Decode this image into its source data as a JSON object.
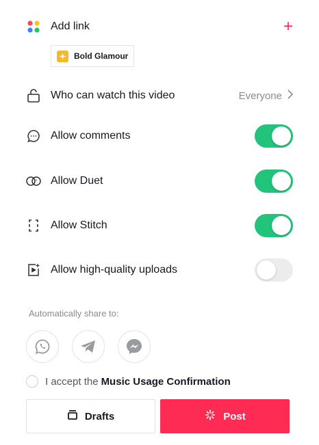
{
  "add_link": {
    "label": "Add link",
    "plus": "+"
  },
  "chip": {
    "label": "Bold Glamour"
  },
  "privacy": {
    "label": "Who can watch this video",
    "value": "Everyone"
  },
  "settings": [
    {
      "label": "Allow comments",
      "enabled": true
    },
    {
      "label": "Allow Duet",
      "enabled": true
    },
    {
      "label": "Allow Stitch",
      "enabled": true
    },
    {
      "label": "Allow high-quality uploads",
      "enabled": false
    }
  ],
  "share": {
    "title": "Automatically share to:",
    "targets": [
      "whatsapp-icon",
      "telegram-icon",
      "messenger-icon"
    ]
  },
  "accept": {
    "prefix": "I accept the",
    "link": "Music Usage Confirmation"
  },
  "buttons": {
    "drafts": "Drafts",
    "post": "Post"
  },
  "colors": {
    "accent": "#fe2c55",
    "toggle_on": "#21c47a",
    "toggle_off": "#ececed"
  }
}
